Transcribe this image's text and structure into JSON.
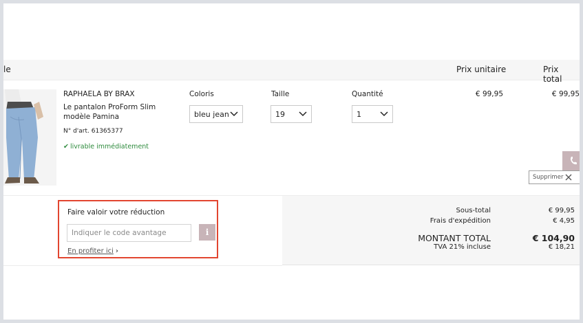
{
  "table_header": {
    "article_fragment": "le",
    "unit_price": "Prix unitaire",
    "total_price": "Prix total"
  },
  "product": {
    "brand": "RAPHAELA BY BRAX",
    "name": "Le pantalon ProForm Slim modèle Pamina",
    "article_number": "N° d'art. 61365377",
    "availability": "livrable immédiatement",
    "availability_color": "#2e8b3d",
    "color_label": "Coloris",
    "color_value": "bleu jean",
    "size_label": "Taille",
    "size_value": "19",
    "quantity_label": "Quantité",
    "quantity_value": "1",
    "unit_price": "€ 99,95",
    "total_price": "€ 99,95",
    "delete_label": "Supprimer",
    "image_icon": "jeans-image"
  },
  "discount": {
    "title": "Faire valoir votre réduction",
    "placeholder": "Indiquer le code avantage",
    "info_glyph": "i",
    "link_label": "En profiter ici",
    "highlight_color": "#e2452f"
  },
  "summary": {
    "subtotal_label": "Sous-total",
    "subtotal_value": "€ 99,95",
    "shipping_label": "Frais d'expédition",
    "shipping_value": "€ 4,95",
    "total_label": "MONTANT TOTAL",
    "total_value": "€ 104,90",
    "vat_label": "TVA 21% incluse",
    "vat_value": "€ 18,21"
  },
  "accent_color": "#c8b4b8"
}
